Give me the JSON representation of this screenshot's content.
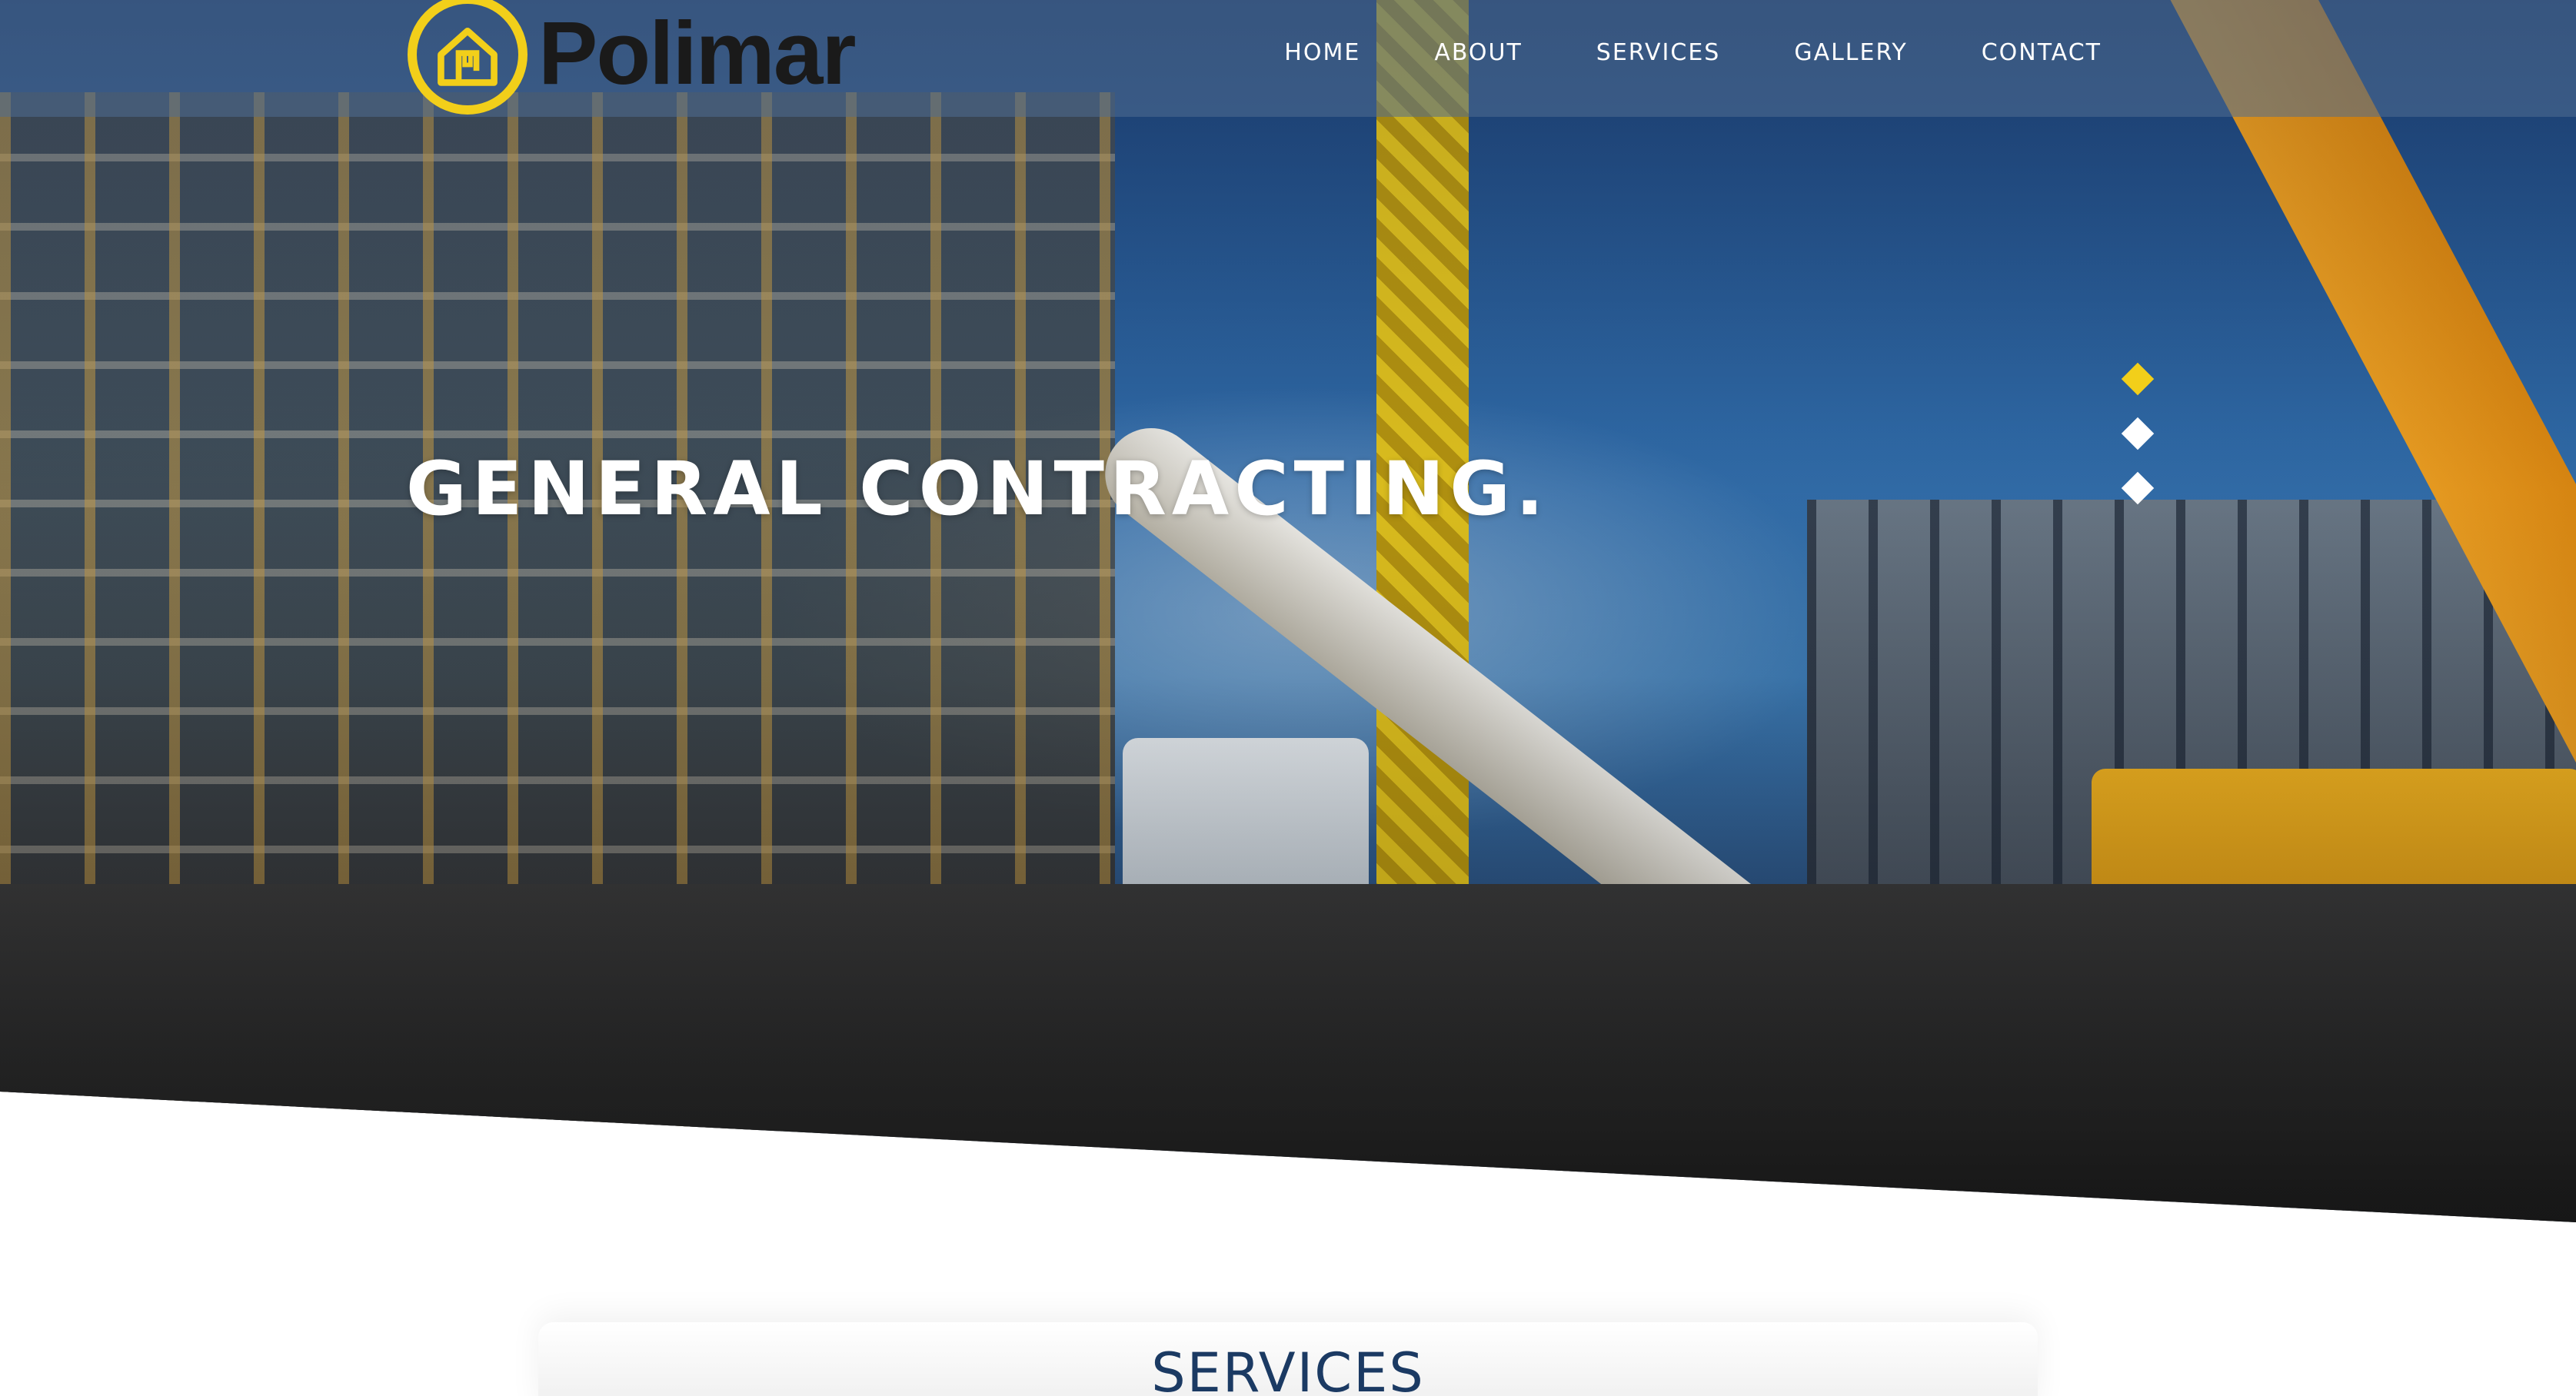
{
  "brand": {
    "name": "Polimar",
    "logo_color": "#f2cf1a",
    "logo_icon": "house-icon"
  },
  "nav": {
    "items": [
      {
        "label": "HOME"
      },
      {
        "label": "ABOUT"
      },
      {
        "label": "SERVICES"
      },
      {
        "label": "GALLERY"
      },
      {
        "label": "CONTACT"
      }
    ]
  },
  "hero": {
    "headline": "GENERAL CONTRACTING.",
    "slides": {
      "count": 3,
      "active_index": 0,
      "active_color": "#f2cf1a",
      "inactive_color": "#ffffff"
    }
  },
  "sections": {
    "services_title": "SERVICES",
    "services_title_color": "#1b3a63"
  }
}
